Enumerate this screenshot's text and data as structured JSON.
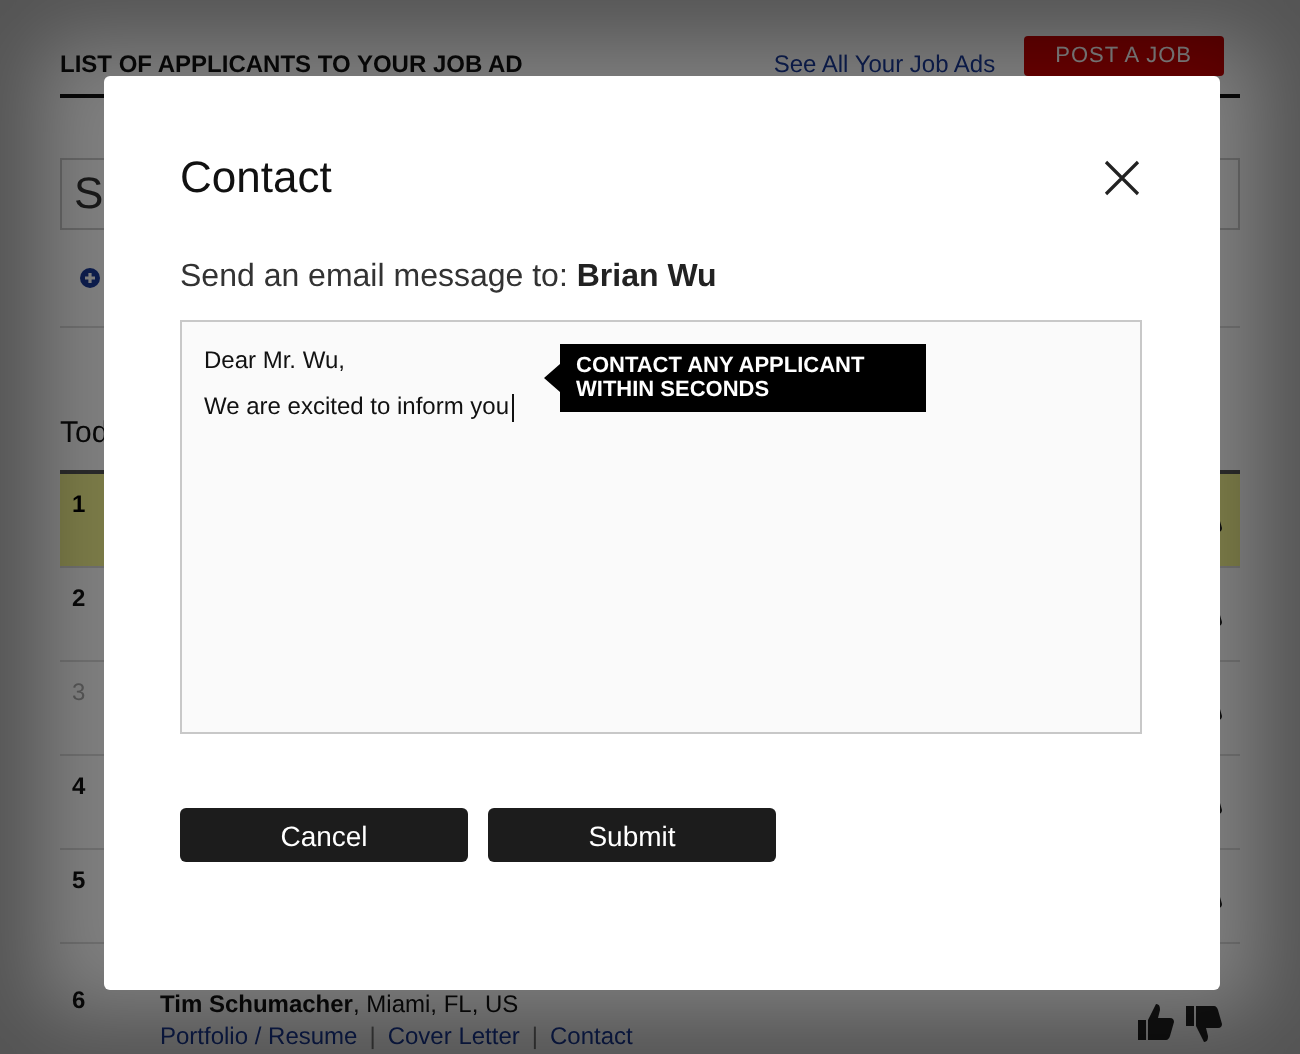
{
  "page": {
    "title": "LIST OF APPLICANTS TO YOUR JOB AD",
    "link": "See All Your Job Ads",
    "post_button": "POST A JOB"
  },
  "search": {
    "value": "S"
  },
  "section_heading": "Tod",
  "rows": [
    {
      "number": "1",
      "selected": true,
      "disabled": false
    },
    {
      "number": "2",
      "selected": false,
      "disabled": false
    },
    {
      "number": "3",
      "selected": false,
      "disabled": true
    },
    {
      "number": "4",
      "selected": false,
      "disabled": false
    },
    {
      "number": "5",
      "selected": false,
      "disabled": false
    },
    {
      "number": "6",
      "selected": false,
      "disabled": false,
      "applicant": {
        "name": "Tim Schumacher",
        "location": ", Miami, FL, US",
        "links": [
          "Portfolio / Resume",
          "Cover Letter",
          "Contact"
        ],
        "separator": "|"
      }
    }
  ],
  "dialog": {
    "title": "Contact",
    "prompt": "Send an email message to:",
    "recipient": "Brian Wu",
    "message_lines": [
      "Dear Mr. Wu,",
      "We are excited to inform you"
    ],
    "tooltip": "CONTACT ANY APPLICANT WITHIN SECONDS",
    "buttons": [
      "Cancel",
      "Submit"
    ]
  }
}
